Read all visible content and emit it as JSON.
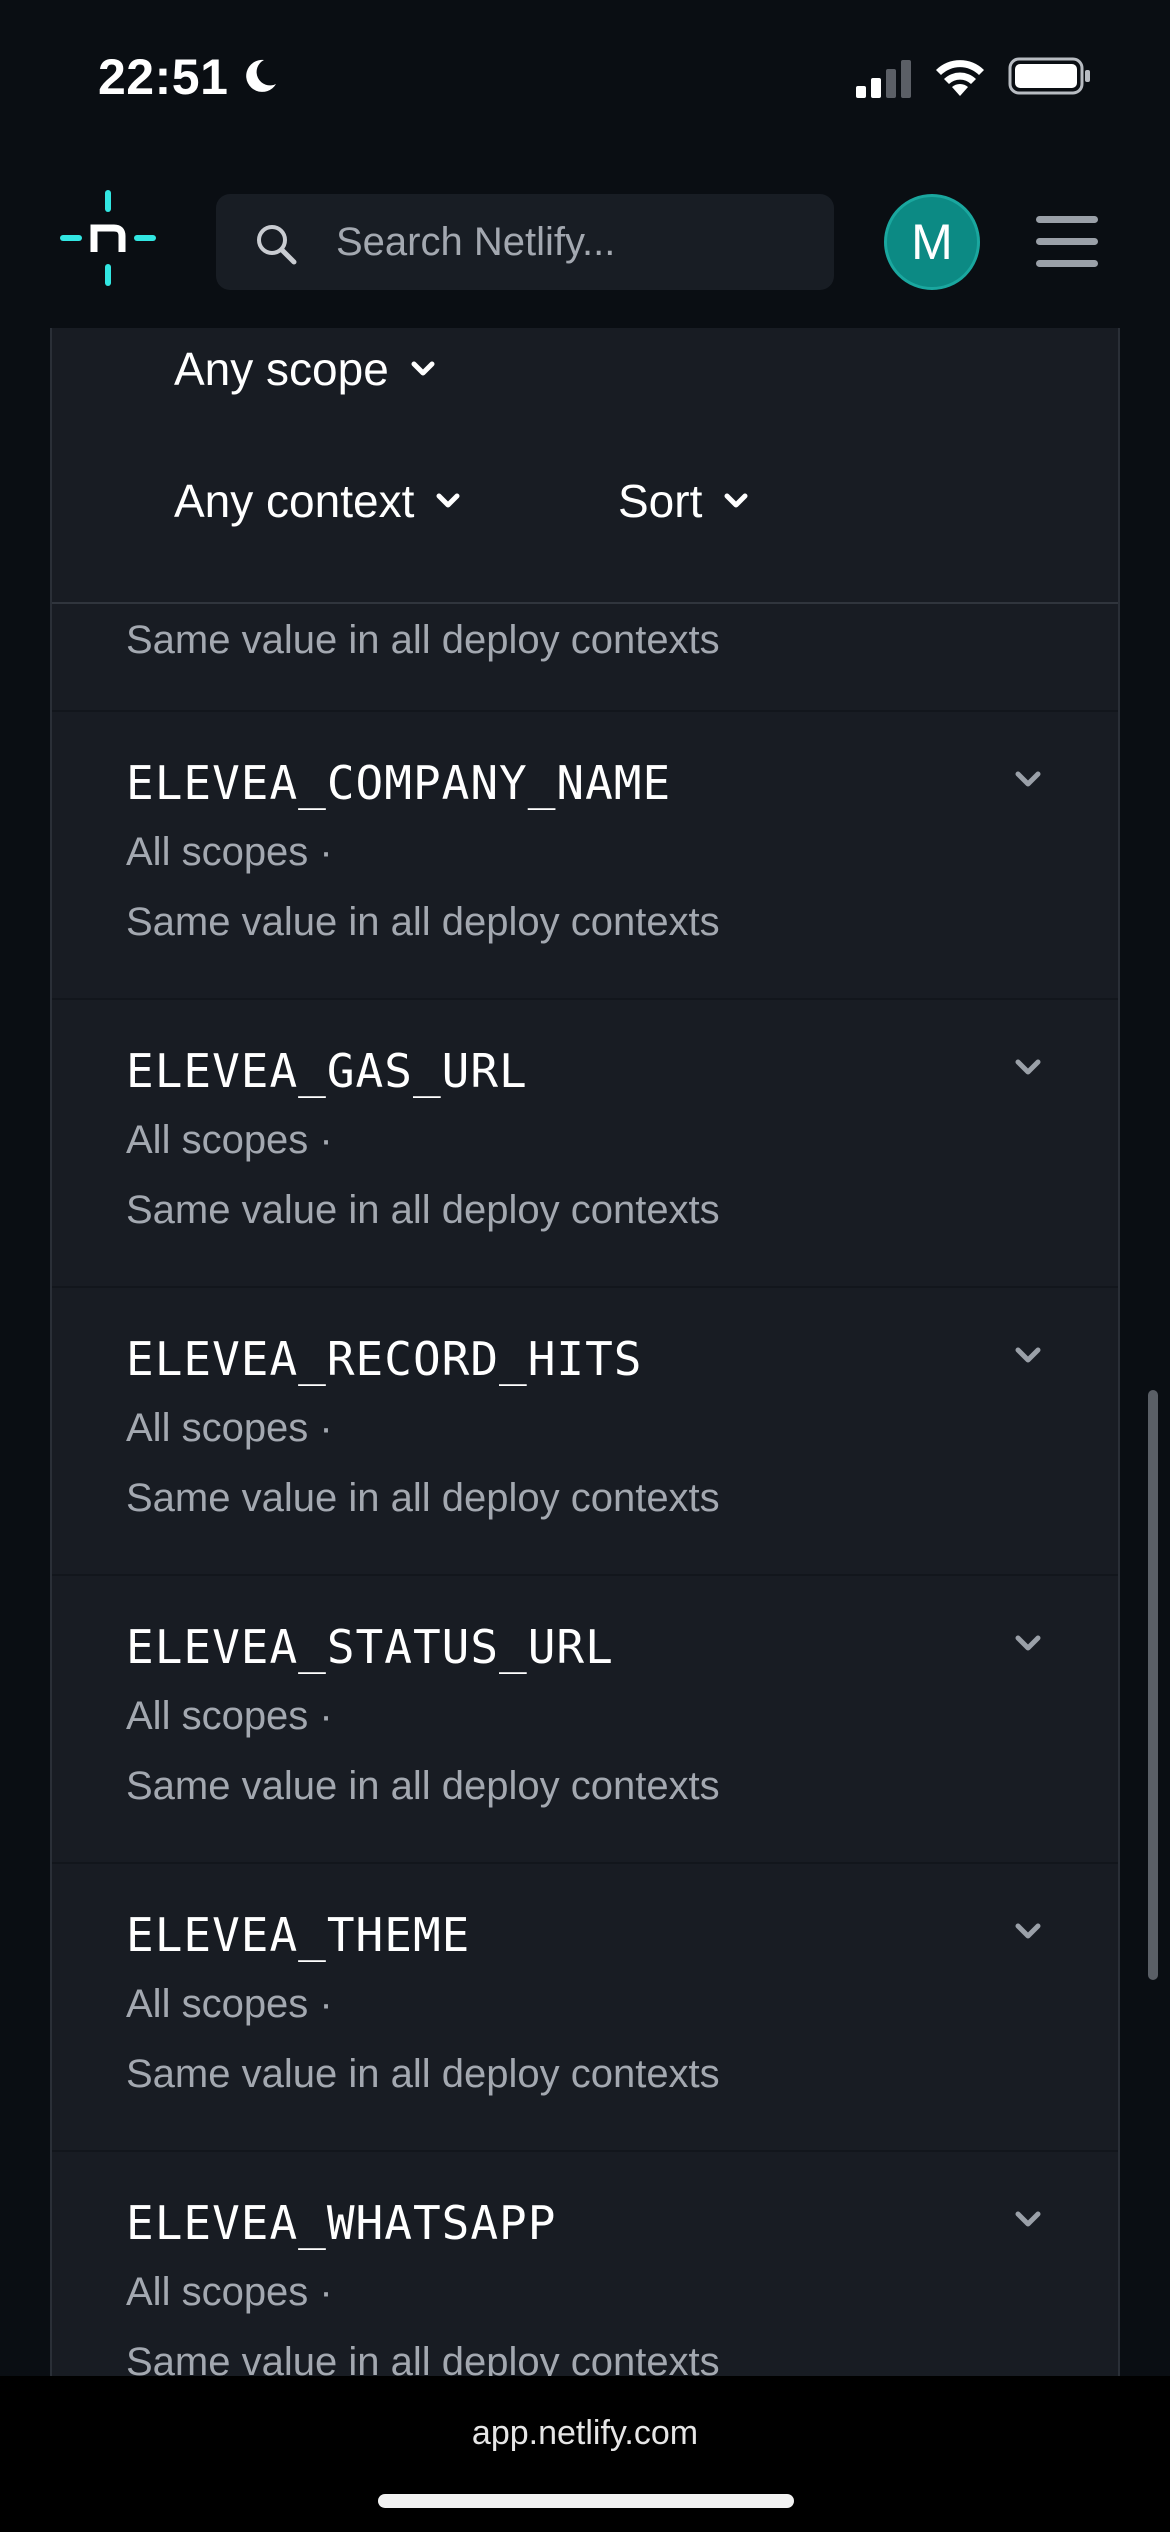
{
  "status_bar": {
    "time": "22:51"
  },
  "header": {
    "search_placeholder": "Search Netlify...",
    "avatar_initial": "M"
  },
  "filters": {
    "scope": "Any scope",
    "context": "Any context",
    "sort": "Sort"
  },
  "partial_row_context": "Same value in all deploy contexts",
  "variables": [
    {
      "name": "ELEVEA_COMPANY_NAME",
      "scopes": "All scopes  ·",
      "contexts": "Same value in all deploy contexts"
    },
    {
      "name": "ELEVEA_GAS_URL",
      "scopes": "All scopes  ·",
      "contexts": "Same value in all deploy contexts"
    },
    {
      "name": "ELEVEA_RECORD_HITS",
      "scopes": "All scopes  ·",
      "contexts": "Same value in all deploy contexts"
    },
    {
      "name": "ELEVEA_STATUS_URL",
      "scopes": "All scopes  ·",
      "contexts": "Same value in all deploy contexts"
    },
    {
      "name": "ELEVEA_THEME",
      "scopes": "All scopes  ·",
      "contexts": "Same value in all deploy contexts"
    },
    {
      "name": "ELEVEA_WHATSAPP",
      "scopes": "All scopes  ·",
      "contexts": "Same value in all deploy contexts"
    }
  ],
  "browser": {
    "url": "app.netlify.com"
  },
  "colors": {
    "accent": "#32e6e2",
    "avatar": "#0c8a84",
    "panel": "#181c23",
    "background": "#0a0e13"
  }
}
